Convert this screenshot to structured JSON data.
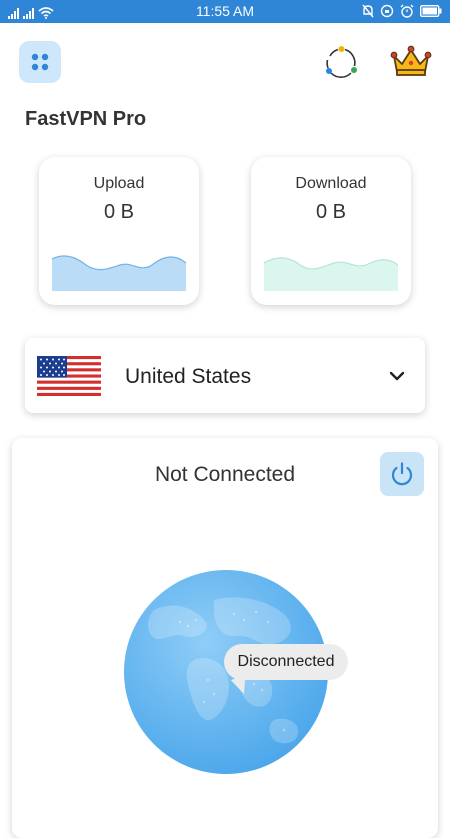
{
  "status_bar": {
    "time": "11:55 AM",
    "background": "#2f86d6"
  },
  "header": {
    "menu_icon": "grid-dots-icon",
    "loader_icon": "refresh-dots-icon",
    "premium_icon": "crown-icon"
  },
  "app": {
    "title": "FastVPN Pro"
  },
  "stats": {
    "upload": {
      "label": "Upload",
      "value": "0 B",
      "color": "#9ccbf2"
    },
    "download": {
      "label": "Download",
      "value": "0 B",
      "color": "#d4f3ea"
    }
  },
  "server": {
    "country": "United States",
    "flag": "us-flag-icon"
  },
  "connection": {
    "status": "Not Connected",
    "state_bubble": "Disconnected",
    "power_icon": "power-icon"
  },
  "colors": {
    "accent": "#2f86d6",
    "globe": "#5eb1ee"
  }
}
